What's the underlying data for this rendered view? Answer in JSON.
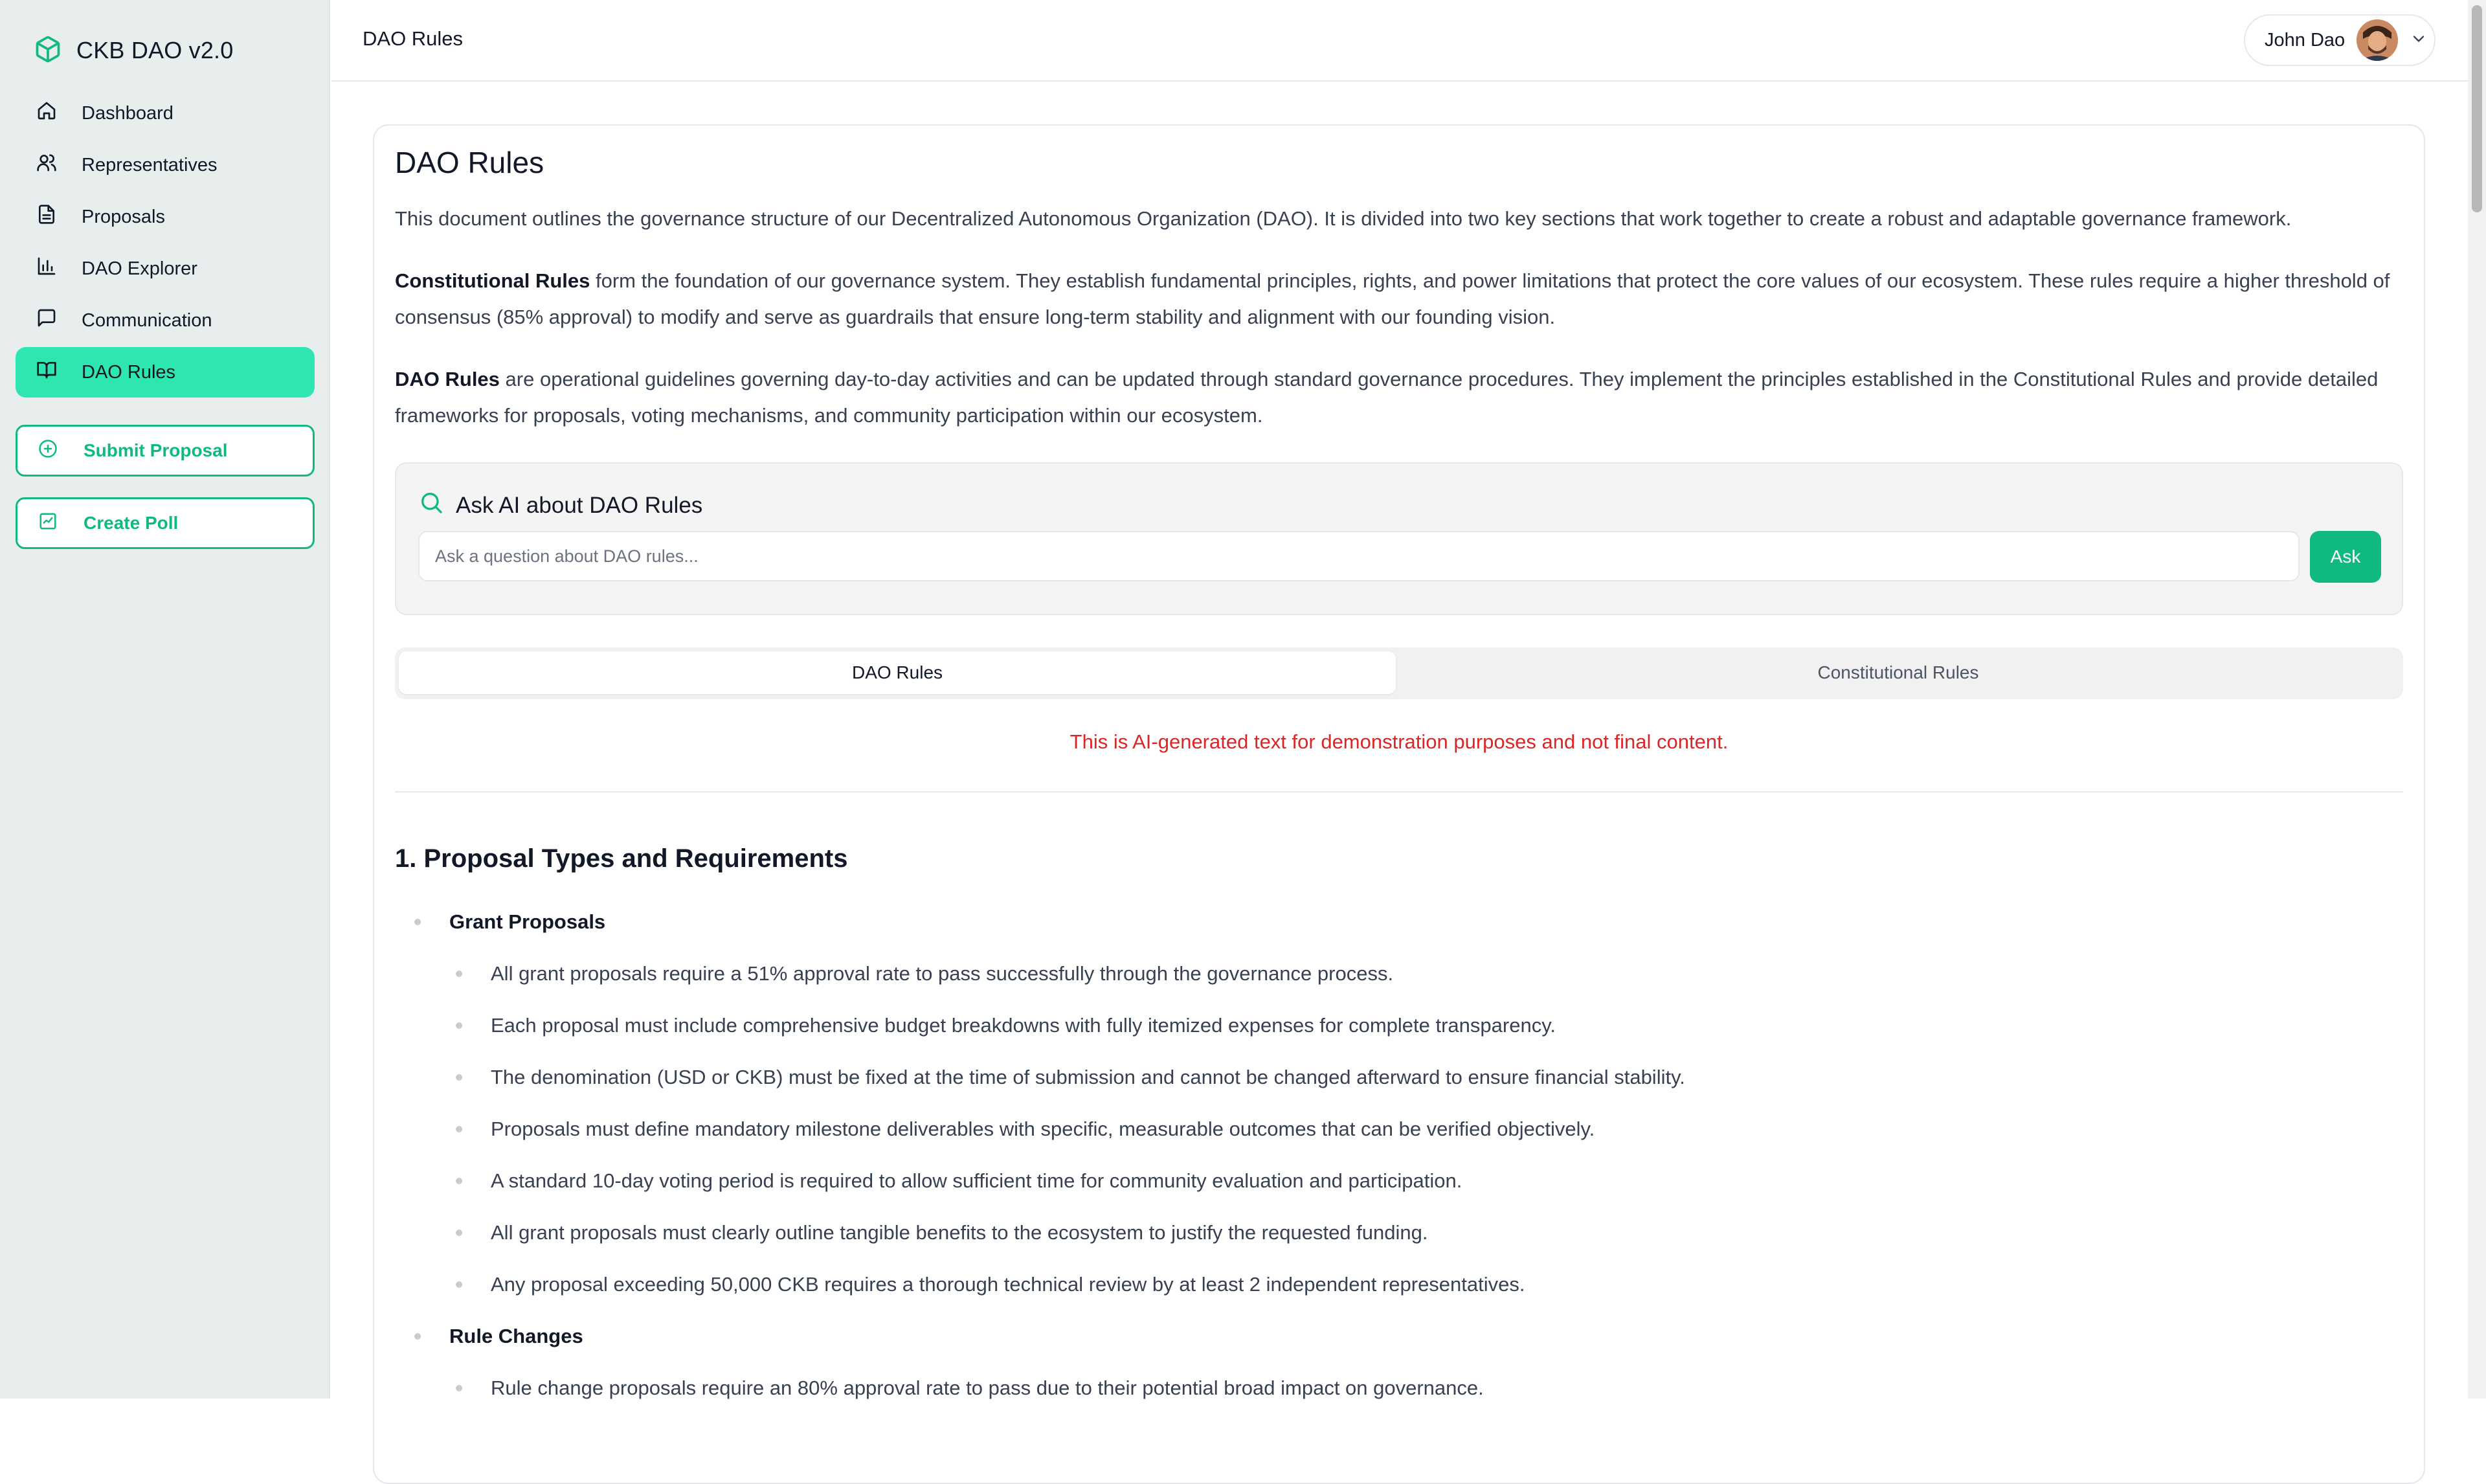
{
  "app": {
    "brand_name": "CKB DAO v2.0",
    "accent_color": "#10b981",
    "active_nav_color": "#2ee6b0"
  },
  "sidebar": {
    "items": [
      {
        "label": "Dashboard",
        "icon": "home-icon"
      },
      {
        "label": "Representatives",
        "icon": "users-icon"
      },
      {
        "label": "Proposals",
        "icon": "document-icon"
      },
      {
        "label": "DAO Explorer",
        "icon": "bar-chart-icon"
      },
      {
        "label": "Communication",
        "icon": "message-icon"
      },
      {
        "label": "DAO Rules",
        "icon": "book-open-icon",
        "active": true
      }
    ],
    "submit_proposal_label": "Submit Proposal",
    "create_poll_label": "Create Poll"
  },
  "header": {
    "title": "DAO Rules",
    "user_name": "John Dao"
  },
  "main": {
    "title": "DAO Rules",
    "intro": "This document outlines the governance structure of our Decentralized Autonomous Organization (DAO). It is divided into two key sections that work together to create a robust and adaptable governance framework.",
    "constitutional": {
      "term": "Constitutional Rules",
      "text": " form the foundation of our governance system. They establish fundamental principles, rights, and power limitations that protect the core values of our ecosystem. These rules require a higher threshold of consensus (85% approval) to modify and serve as guardrails that ensure long-term stability and alignment with our founding vision."
    },
    "dao_rules": {
      "term": "DAO Rules",
      "text": " are operational guidelines governing day-to-day activities and can be updated through standard governance procedures. They implement the principles established in the Constitutional Rules and provide detailed frameworks for proposals, voting mechanisms, and community participation within our ecosystem."
    },
    "ask_ai": {
      "title": "Ask AI about DAO Rules",
      "placeholder": "Ask a question about DAO rules...",
      "value": "",
      "button_label": "Ask"
    },
    "tabs": [
      {
        "label": "DAO Rules",
        "active": true
      },
      {
        "label": "Constitutional Rules",
        "active": false
      }
    ],
    "notice": "This is AI-generated text for demonstration purposes and not final content.",
    "section": {
      "heading": "1. Proposal Types and Requirements",
      "groups": [
        {
          "title": "Grant Proposals",
          "items": [
            "All grant proposals require a 51% approval rate to pass successfully through the governance process.",
            "Each proposal must include comprehensive budget breakdowns with fully itemized expenses for complete transparency.",
            "The denomination (USD or CKB) must be fixed at the time of submission and cannot be changed afterward to ensure financial stability.",
            "Proposals must define mandatory milestone deliverables with specific, measurable outcomes that can be verified objectively.",
            "A standard 10-day voting period is required to allow sufficient time for community evaluation and participation.",
            "All grant proposals must clearly outline tangible benefits to the ecosystem to justify the requested funding.",
            "Any proposal exceeding 50,000 CKB requires a thorough technical review by at least 2 independent representatives."
          ]
        },
        {
          "title": "Rule Changes",
          "items": [
            "Rule change proposals require an 80% approval rate to pass due to their potential broad impact on governance."
          ]
        }
      ]
    }
  }
}
